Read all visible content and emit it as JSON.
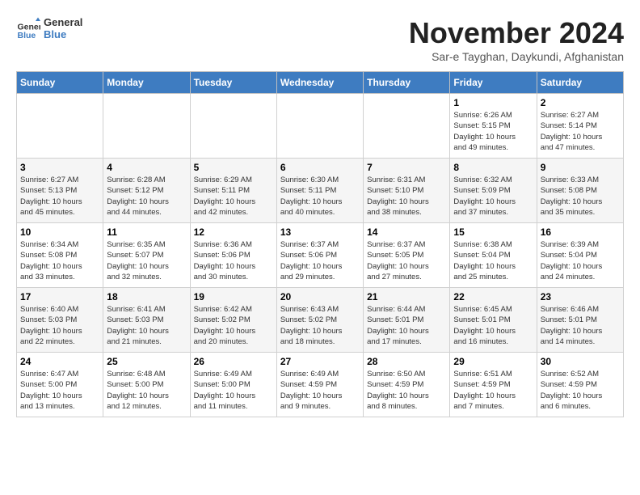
{
  "header": {
    "logo_line1": "General",
    "logo_line2": "Blue",
    "month_title": "November 2024",
    "location": "Sar-e Tayghan, Daykundi, Afghanistan"
  },
  "days_of_week": [
    "Sunday",
    "Monday",
    "Tuesday",
    "Wednesday",
    "Thursday",
    "Friday",
    "Saturday"
  ],
  "weeks": [
    [
      {
        "day": "",
        "info": ""
      },
      {
        "day": "",
        "info": ""
      },
      {
        "day": "",
        "info": ""
      },
      {
        "day": "",
        "info": ""
      },
      {
        "day": "",
        "info": ""
      },
      {
        "day": "1",
        "info": "Sunrise: 6:26 AM\nSunset: 5:15 PM\nDaylight: 10 hours\nand 49 minutes."
      },
      {
        "day": "2",
        "info": "Sunrise: 6:27 AM\nSunset: 5:14 PM\nDaylight: 10 hours\nand 47 minutes."
      }
    ],
    [
      {
        "day": "3",
        "info": "Sunrise: 6:27 AM\nSunset: 5:13 PM\nDaylight: 10 hours\nand 45 minutes."
      },
      {
        "day": "4",
        "info": "Sunrise: 6:28 AM\nSunset: 5:12 PM\nDaylight: 10 hours\nand 44 minutes."
      },
      {
        "day": "5",
        "info": "Sunrise: 6:29 AM\nSunset: 5:11 PM\nDaylight: 10 hours\nand 42 minutes."
      },
      {
        "day": "6",
        "info": "Sunrise: 6:30 AM\nSunset: 5:11 PM\nDaylight: 10 hours\nand 40 minutes."
      },
      {
        "day": "7",
        "info": "Sunrise: 6:31 AM\nSunset: 5:10 PM\nDaylight: 10 hours\nand 38 minutes."
      },
      {
        "day": "8",
        "info": "Sunrise: 6:32 AM\nSunset: 5:09 PM\nDaylight: 10 hours\nand 37 minutes."
      },
      {
        "day": "9",
        "info": "Sunrise: 6:33 AM\nSunset: 5:08 PM\nDaylight: 10 hours\nand 35 minutes."
      }
    ],
    [
      {
        "day": "10",
        "info": "Sunrise: 6:34 AM\nSunset: 5:08 PM\nDaylight: 10 hours\nand 33 minutes."
      },
      {
        "day": "11",
        "info": "Sunrise: 6:35 AM\nSunset: 5:07 PM\nDaylight: 10 hours\nand 32 minutes."
      },
      {
        "day": "12",
        "info": "Sunrise: 6:36 AM\nSunset: 5:06 PM\nDaylight: 10 hours\nand 30 minutes."
      },
      {
        "day": "13",
        "info": "Sunrise: 6:37 AM\nSunset: 5:06 PM\nDaylight: 10 hours\nand 29 minutes."
      },
      {
        "day": "14",
        "info": "Sunrise: 6:37 AM\nSunset: 5:05 PM\nDaylight: 10 hours\nand 27 minutes."
      },
      {
        "day": "15",
        "info": "Sunrise: 6:38 AM\nSunset: 5:04 PM\nDaylight: 10 hours\nand 25 minutes."
      },
      {
        "day": "16",
        "info": "Sunrise: 6:39 AM\nSunset: 5:04 PM\nDaylight: 10 hours\nand 24 minutes."
      }
    ],
    [
      {
        "day": "17",
        "info": "Sunrise: 6:40 AM\nSunset: 5:03 PM\nDaylight: 10 hours\nand 22 minutes."
      },
      {
        "day": "18",
        "info": "Sunrise: 6:41 AM\nSunset: 5:03 PM\nDaylight: 10 hours\nand 21 minutes."
      },
      {
        "day": "19",
        "info": "Sunrise: 6:42 AM\nSunset: 5:02 PM\nDaylight: 10 hours\nand 20 minutes."
      },
      {
        "day": "20",
        "info": "Sunrise: 6:43 AM\nSunset: 5:02 PM\nDaylight: 10 hours\nand 18 minutes."
      },
      {
        "day": "21",
        "info": "Sunrise: 6:44 AM\nSunset: 5:01 PM\nDaylight: 10 hours\nand 17 minutes."
      },
      {
        "day": "22",
        "info": "Sunrise: 6:45 AM\nSunset: 5:01 PM\nDaylight: 10 hours\nand 16 minutes."
      },
      {
        "day": "23",
        "info": "Sunrise: 6:46 AM\nSunset: 5:01 PM\nDaylight: 10 hours\nand 14 minutes."
      }
    ],
    [
      {
        "day": "24",
        "info": "Sunrise: 6:47 AM\nSunset: 5:00 PM\nDaylight: 10 hours\nand 13 minutes."
      },
      {
        "day": "25",
        "info": "Sunrise: 6:48 AM\nSunset: 5:00 PM\nDaylight: 10 hours\nand 12 minutes."
      },
      {
        "day": "26",
        "info": "Sunrise: 6:49 AM\nSunset: 5:00 PM\nDaylight: 10 hours\nand 11 minutes."
      },
      {
        "day": "27",
        "info": "Sunrise: 6:49 AM\nSunset: 4:59 PM\nDaylight: 10 hours\nand 9 minutes."
      },
      {
        "day": "28",
        "info": "Sunrise: 6:50 AM\nSunset: 4:59 PM\nDaylight: 10 hours\nand 8 minutes."
      },
      {
        "day": "29",
        "info": "Sunrise: 6:51 AM\nSunset: 4:59 PM\nDaylight: 10 hours\nand 7 minutes."
      },
      {
        "day": "30",
        "info": "Sunrise: 6:52 AM\nSunset: 4:59 PM\nDaylight: 10 hours\nand 6 minutes."
      }
    ]
  ]
}
